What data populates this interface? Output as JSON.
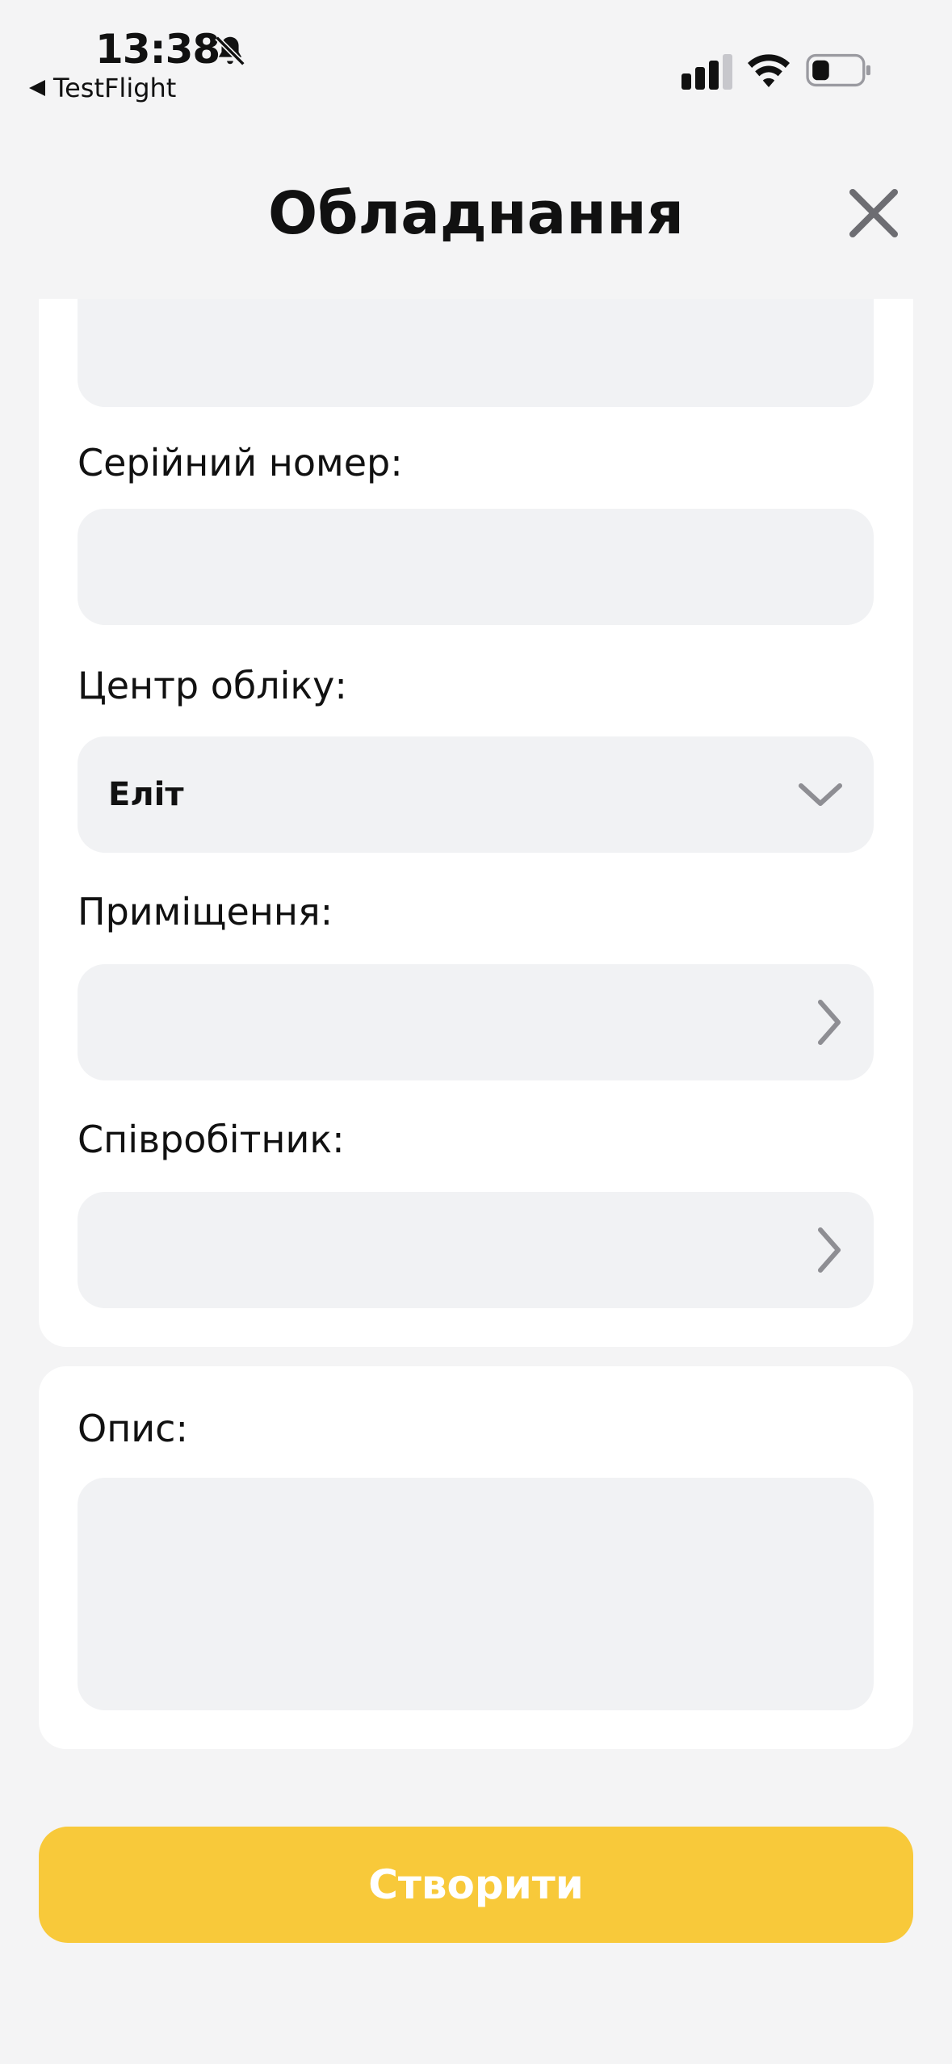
{
  "status_bar": {
    "time": "13:38",
    "back_app": "TestFlight",
    "icons": [
      "bell-slash-icon",
      "signal-icon",
      "wifi-icon",
      "battery-icon"
    ]
  },
  "header": {
    "title": "Обладнання",
    "close_icon": "close-icon"
  },
  "form": {
    "top_field_value": "",
    "serial_number": {
      "label": "Серійний номер:",
      "value": ""
    },
    "accounting_center": {
      "label": "Центр обліку:",
      "value": "Еліт"
    },
    "room": {
      "label": "Приміщення:",
      "value": ""
    },
    "employee": {
      "label": "Співробітник:",
      "value": ""
    },
    "description": {
      "label": "Опис:",
      "value": ""
    }
  },
  "actions": {
    "create_label": "Створити"
  },
  "colors": {
    "background": "#f4f4f5",
    "card": "#ffffff",
    "field": "#f1f2f4",
    "accent": "#f8c93a",
    "chevron": "#8e8e93"
  }
}
